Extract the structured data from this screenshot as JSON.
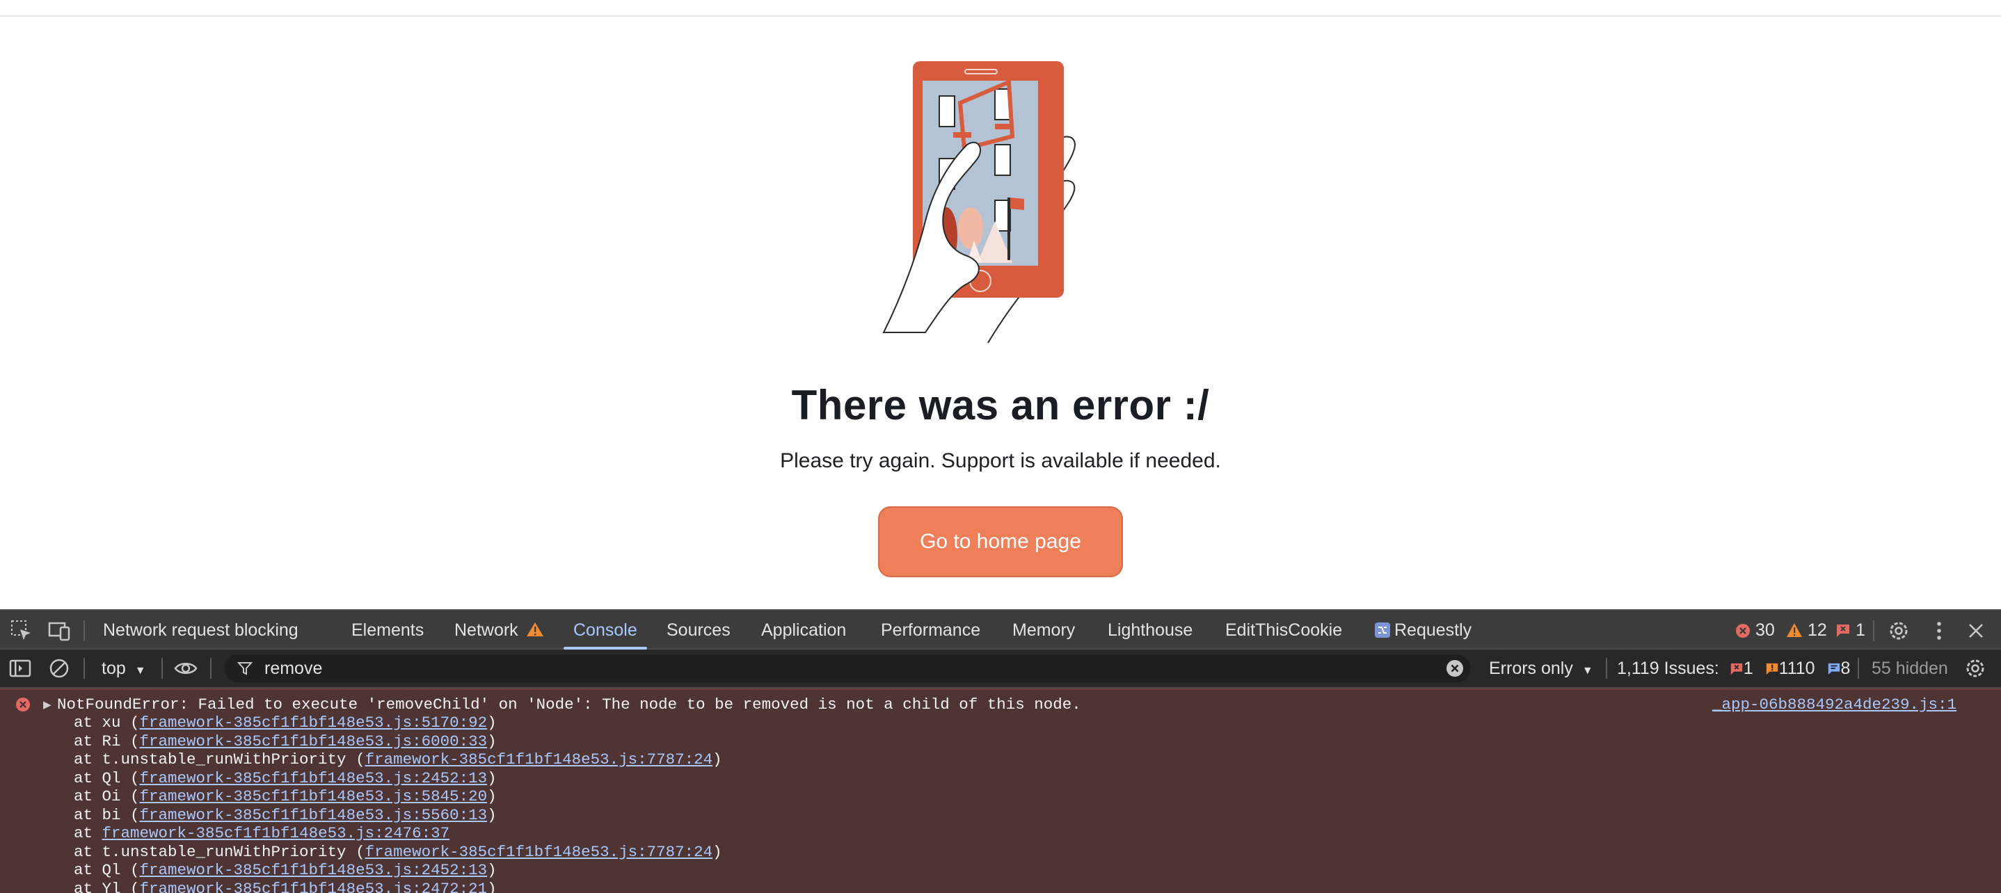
{
  "page": {
    "title": "There was an error :/",
    "subtitle": "Please try again. Support is available if needed.",
    "home_button": "Go to home page",
    "colors": {
      "button": "#ef7f58",
      "phone": "#d95b3d",
      "title": "#1a1d21"
    }
  },
  "devtools": {
    "tabs": [
      {
        "label": "Network request blocking"
      },
      {
        "label": "Elements"
      },
      {
        "label": "Network"
      },
      {
        "label": "Console",
        "active": true
      },
      {
        "label": "Sources"
      },
      {
        "label": "Application"
      },
      {
        "label": "Performance"
      },
      {
        "label": "Memory"
      },
      {
        "label": "Lighthouse"
      },
      {
        "label": "EditThisCookie"
      },
      {
        "label": "Requestly"
      }
    ],
    "counts": {
      "errors": "30",
      "warnings": "12",
      "issues": "1"
    },
    "filterbar": {
      "context": "top",
      "filter_value": "remove",
      "level": "Errors only",
      "issues_label": "1,119 Issues:",
      "issues_error": "1",
      "issues_warning": "1110",
      "issues_info": "8",
      "hidden": "55 hidden"
    },
    "console": {
      "error_message": "NotFoundError: Failed to execute 'removeChild' on 'Node': The node to be removed is not a child of this node.",
      "source": "_app-06b888492a4de239.js:1",
      "stack": [
        {
          "prefix": "at xu (",
          "link": "framework-385cf1f1bf148e53.js:5170:92",
          "suffix": ")"
        },
        {
          "prefix": "at Ri (",
          "link": "framework-385cf1f1bf148e53.js:6000:33",
          "suffix": ")"
        },
        {
          "prefix": "at t.unstable_runWithPriority (",
          "link": "framework-385cf1f1bf148e53.js:7787:24",
          "suffix": ")"
        },
        {
          "prefix": "at Ql (",
          "link": "framework-385cf1f1bf148e53.js:2452:13",
          "suffix": ")"
        },
        {
          "prefix": "at Oi (",
          "link": "framework-385cf1f1bf148e53.js:5845:20",
          "suffix": ")"
        },
        {
          "prefix": "at bi (",
          "link": "framework-385cf1f1bf148e53.js:5560:13",
          "suffix": ")"
        },
        {
          "prefix": "at ",
          "link": "framework-385cf1f1bf148e53.js:2476:37",
          "suffix": ""
        },
        {
          "prefix": "at t.unstable_runWithPriority (",
          "link": "framework-385cf1f1bf148e53.js:7787:24",
          "suffix": ")"
        },
        {
          "prefix": "at Ql (",
          "link": "framework-385cf1f1bf148e53.js:2452:13",
          "suffix": ")"
        },
        {
          "prefix": "at Yl (",
          "link": "framework-385cf1f1bf148e53.js:2472:21",
          "suffix": ")"
        }
      ]
    },
    "icons": [
      "inspect-icon",
      "device-toolbar-icon",
      "warning-icon",
      "requestly-icon",
      "settings-icon",
      "more-vertical-icon",
      "close-icon",
      "sidebar-icon",
      "clear-icon",
      "eye-icon",
      "filter-icon",
      "clear-filter-icon",
      "error-icon"
    ]
  }
}
